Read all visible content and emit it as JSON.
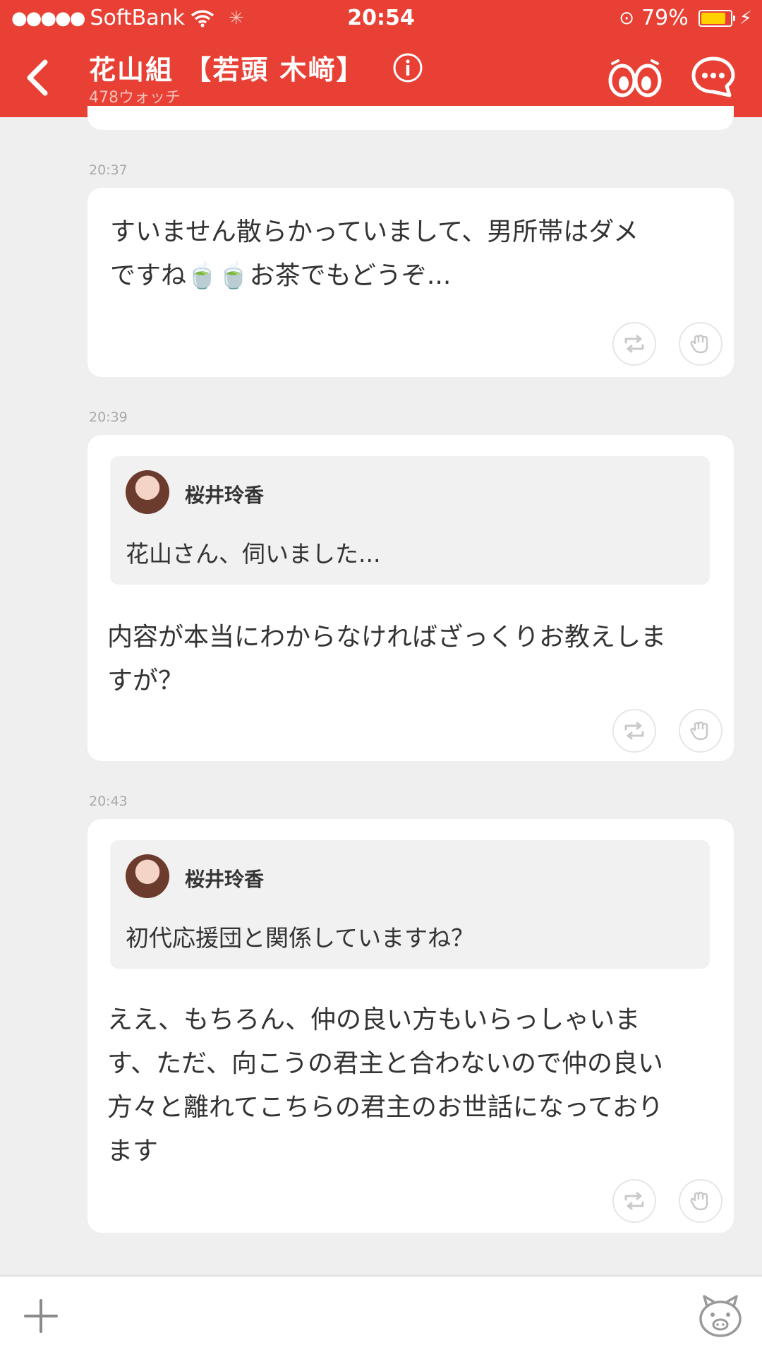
{
  "status_bar": {
    "carrier": "SoftBank",
    "time": "20:54",
    "battery": "79%",
    "battery_level": 0.79
  },
  "header": {
    "title": "花山組 【若頭 木﨑】",
    "subtitle": "478ウォッチ",
    "icons": [
      "back-icon",
      "info-icon",
      "watch-eyes-icon",
      "chat-icon"
    ]
  },
  "messages": [
    {
      "time": "20:37",
      "text_lines": [
        "すいません散らかっていまして、男所帯はダメ",
        "ですね🍵🍵お茶でもどうぞ..."
      ]
    },
    {
      "time": "20:39",
      "quote": {
        "name": "桜井玲香",
        "text": "花山さん、伺いました..."
      },
      "text_lines": [
        "内容が本当にわからなければざっくりお教えしま",
        "すが？"
      ]
    },
    {
      "time": "20:43",
      "quote": {
        "name": "桜井玲香",
        "text": "初代応援団と関係していますね？"
      },
      "text_lines": [
        "ええ、もちろん、仲の良い方もいらっしゃいま",
        "す、ただ、向こうの君主と合わないので仲の良い",
        "方々と離れてこちらの君主のお世話になっており",
        "ます"
      ]
    }
  ],
  "bottom_bar": {
    "icons": [
      "plus-icon",
      "pig-stamp-icon"
    ]
  },
  "colors": {
    "accent": "#e84034",
    "background": "#efefef",
    "card": "#ffffff"
  }
}
